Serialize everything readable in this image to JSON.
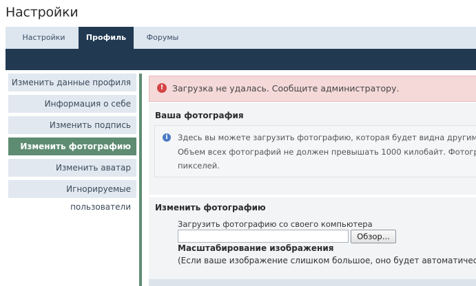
{
  "page_title": "Настройки",
  "tabs": [
    {
      "label": "Настройки",
      "active": false
    },
    {
      "label": "Профиль",
      "active": true
    },
    {
      "label": "Форумы",
      "active": false
    }
  ],
  "sidebar": {
    "items": [
      {
        "label": "Изменить данные профиля",
        "active": false
      },
      {
        "label": "Информация о себе",
        "active": false
      },
      {
        "label": "Изменить подпись",
        "active": false
      },
      {
        "label": "Изменить фотографию",
        "active": true
      },
      {
        "label": "Изменить аватар",
        "active": false
      },
      {
        "label": "Игнорируемые пользователи",
        "active": false
      }
    ]
  },
  "error": {
    "icon": "error-icon",
    "text": "Загрузка не удалась. Сообщите администратору."
  },
  "photo_section": {
    "title": "Ваша фотография",
    "info_icon": "info-icon",
    "info_lines": [
      "Здесь вы можете загрузить фотографию, которая будет видна другим п",
      "Объем всех фотографий не должен превышать 1000 килобайт. Фотогра",
      "пикселей."
    ]
  },
  "change_section": {
    "title": "Изменить фотографию",
    "upload_label": "Загрузить фотографию со своего компьютера",
    "file_value": "",
    "browse_label": "Обзор...",
    "scale_title": "Масштабирование изображения",
    "scale_note": "(Если ваше изображение слишком большое, оно будет автоматически у"
  },
  "colors": {
    "nav_dark": "#213a52",
    "tabbar_bg": "#dde6ef",
    "active_green": "#5e8c72",
    "sidebar_bg": "#e1e8f0",
    "error_bg": "#f5d9d9",
    "error_icon": "#d64545",
    "info_icon": "#4a79c4"
  }
}
